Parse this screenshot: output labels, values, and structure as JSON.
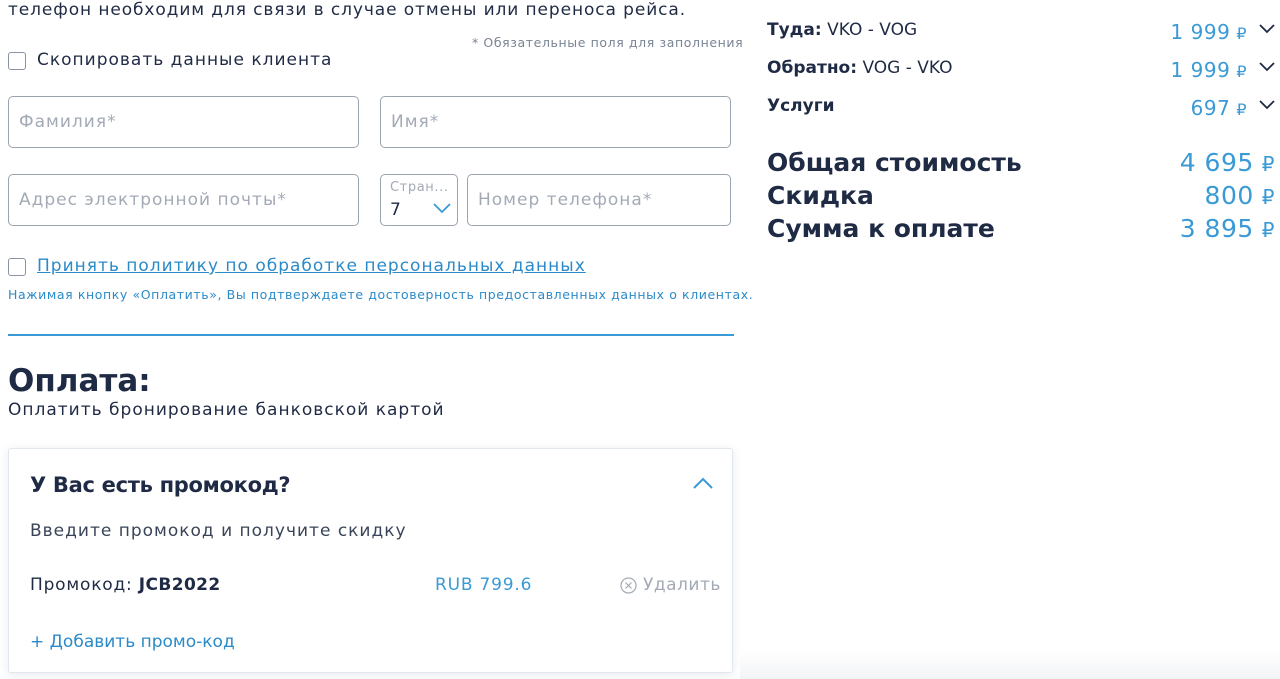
{
  "form": {
    "intro_text": "телефон необходим для связи в случае отмены или переноса рейса.",
    "required_note": "* Обязательные поля для заполнения",
    "copy_client_label": "Скопировать данные клиента",
    "surname_placeholder": "Фамилия*",
    "name_placeholder": "Имя*",
    "email_placeholder": "Адрес электронной почты*",
    "country_label": "Стран...",
    "country_value": "7",
    "phone_placeholder": "Номер телефона*",
    "policy_link": "Принять политику по обработке персональных данных",
    "policy_note": "Нажимая кнопку «Оплатить», Вы подтверждаете достоверность предоставленных данных о клиентах."
  },
  "payment": {
    "title": "Оплата:",
    "subtitle": "Оплатить бронирование банковской картой"
  },
  "promo": {
    "title": "У Вас есть промокод?",
    "hint": "Введите промокод и получите скидку",
    "code_label": "Промокод: ",
    "code_value": "JCB2022",
    "amount": "RUB 799.6",
    "remove_label": "Удалить",
    "add_label": "+ Добавить промо-код"
  },
  "summary": {
    "currency_symbol": "₽",
    "rows": [
      {
        "label": "Туда:",
        "route": " VKO - VOG",
        "price": "1 999"
      },
      {
        "label": "Обратно:",
        "route": " VOG - VKO",
        "price": "1 999"
      },
      {
        "label": "Услуги",
        "route": "",
        "price": "697"
      }
    ],
    "total_label": "Общая стоимость",
    "total_value": "4 695",
    "discount_label": "Скидка",
    "discount_value": "800",
    "pay_label": "Сумма к оплате",
    "pay_value": "3 895"
  },
  "colors": {
    "accent": "#3a9ad6",
    "link": "#2b8ac8",
    "text": "#1f2a44",
    "placeholder": "#a3aab6"
  }
}
